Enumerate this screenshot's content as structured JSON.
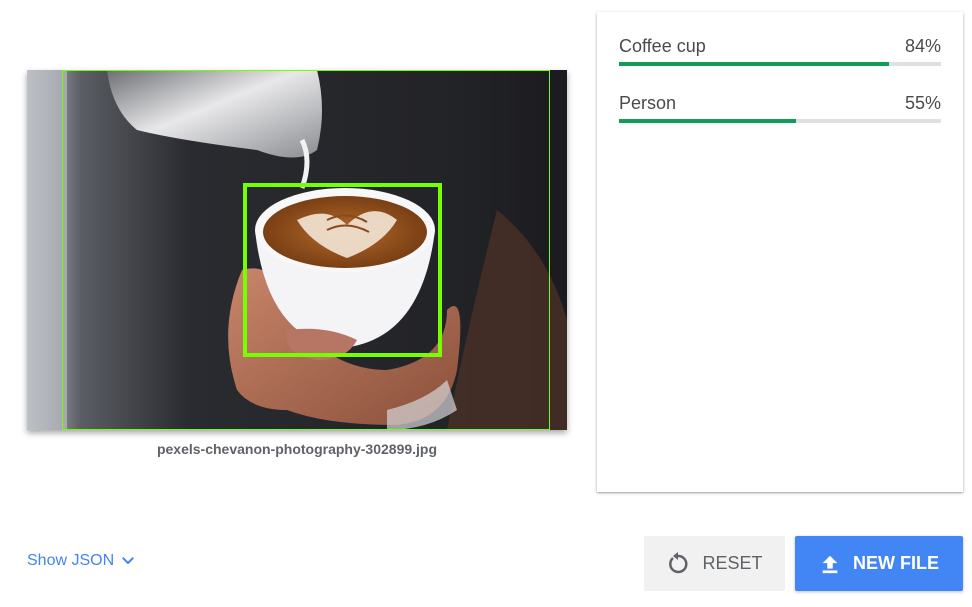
{
  "image": {
    "filename": "pexels-chevanon-photography-302899.jpg",
    "detections": [
      {
        "label": "Person",
        "box_color": "#76ff03"
      },
      {
        "label": "Coffee cup",
        "box_color": "#76ff03"
      }
    ]
  },
  "results": [
    {
      "label": "Coffee cup",
      "percent_text": "84%",
      "score": 0.84
    },
    {
      "label": "Person",
      "percent_text": "55%",
      "score": 0.55
    }
  ],
  "colors": {
    "bar_fill": "#0f9d58",
    "bar_track": "#e0e0e0",
    "accent": "#4285f4",
    "box": "#76ff03"
  },
  "footer": {
    "show_json_label": "Show JSON",
    "show_json_icon": "chevron-down-icon",
    "reset_label": "RESET",
    "reset_icon": "reset-icon",
    "new_file_label": "NEW FILE",
    "new_file_icon": "upload-icon"
  }
}
